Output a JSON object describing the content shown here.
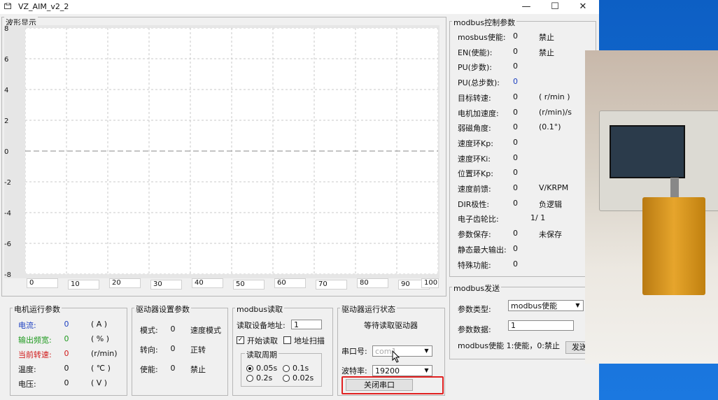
{
  "window": {
    "title": "VZ_AIM_v2_2",
    "min_glyph": "—",
    "max_glyph": "☐",
    "close_glyph": "✕"
  },
  "waveform": {
    "title": "波形显示",
    "y_labels": [
      "8",
      "6",
      "4",
      "2",
      "0",
      "-2",
      "-4",
      "-6",
      "-8"
    ],
    "x_labels": [
      "0",
      "10",
      "20",
      "30",
      "40",
      "50",
      "60",
      "70",
      "80",
      "90",
      "100"
    ]
  },
  "motor_params": {
    "title": "电机运行参数",
    "rows": [
      {
        "label": "电流:",
        "value": "0",
        "unit": "( A )",
        "color": "#1c3fc0"
      },
      {
        "label": "输出频宽:",
        "value": "0",
        "unit": "( % )",
        "color": "#1f9a1f"
      },
      {
        "label": "当前转速:",
        "value": "0",
        "unit": "(r/min)",
        "color": "#d01818"
      },
      {
        "label": "温度:",
        "value": "0",
        "unit": "( ℃ )",
        "color": "#111111"
      },
      {
        "label": "电压:",
        "value": "0",
        "unit": "( V )",
        "color": "#111111"
      }
    ]
  },
  "driver_settings": {
    "title": "驱动器设置参数",
    "rows": [
      {
        "label": "模式:",
        "value": "0",
        "desc": "速度模式"
      },
      {
        "label": "转向:",
        "value": "0",
        "desc": "正转"
      },
      {
        "label": "使能:",
        "value": "0",
        "desc": "禁止"
      }
    ]
  },
  "modbus_read": {
    "title": "modbus读取",
    "addr_label": "读取设备地址:",
    "addr_value": "1",
    "start_read_label": "开始读取",
    "start_read_checked": "✓",
    "addr_scan_label": "地址扫描",
    "period_title": "读取周期",
    "periods": [
      "0.05s",
      "0.1s",
      "0.2s",
      "0.02s"
    ]
  },
  "driver_status": {
    "title": "驱动器运行状态",
    "status_text": "等待读取驱动器",
    "port_label": "串口号:",
    "port_value": "com1",
    "baud_label": "波特率:",
    "baud_value": "19200",
    "close_port_button": "关闭串口"
  },
  "modbus_control": {
    "title": "modbus控制参数",
    "rows": [
      {
        "label": "mosbus使能:",
        "value": "0",
        "desc": "禁止"
      },
      {
        "label": "EN(使能):",
        "value": "0",
        "desc": "禁止"
      },
      {
        "label": "PU(步数):",
        "value": "0",
        "desc": ""
      },
      {
        "label": "PU(总步数):",
        "value": "0",
        "desc": ""
      },
      {
        "label": "目标转速:",
        "value": "0",
        "desc": "( r/min )"
      },
      {
        "label": "电机加速度:",
        "value": "0",
        "desc": "(r/min)/s"
      },
      {
        "label": "弱磁角度:",
        "value": "0",
        "desc": "(0.1°)"
      },
      {
        "label": "速度环Kp:",
        "value": "0",
        "desc": ""
      },
      {
        "label": "速度环Ki:",
        "value": "0",
        "desc": ""
      },
      {
        "label": "位置环Kp:",
        "value": "0",
        "desc": ""
      },
      {
        "label": "速度前馈:",
        "value": "0",
        "desc": "V/KRPM"
      },
      {
        "label": "DIR极性:",
        "value": "0",
        "desc": "负逻辑"
      },
      {
        "label": "电子齿轮比:",
        "value": "1/ 1",
        "desc": ""
      },
      {
        "label": "参数保存:",
        "value": "0",
        "desc": "未保存"
      },
      {
        "label": "静态最大输出:",
        "value": "0",
        "desc": ""
      },
      {
        "label": "特殊功能:",
        "value": "0",
        "desc": ""
      }
    ]
  },
  "modbus_send": {
    "title": "modbus发送",
    "param_type_label": "参数类型:",
    "param_type_value": "modbus使能",
    "param_data_label": "参数数据:",
    "param_data_value": "1",
    "hint": "modbus使能 1:使能，0:禁止",
    "send_button": "发送"
  }
}
